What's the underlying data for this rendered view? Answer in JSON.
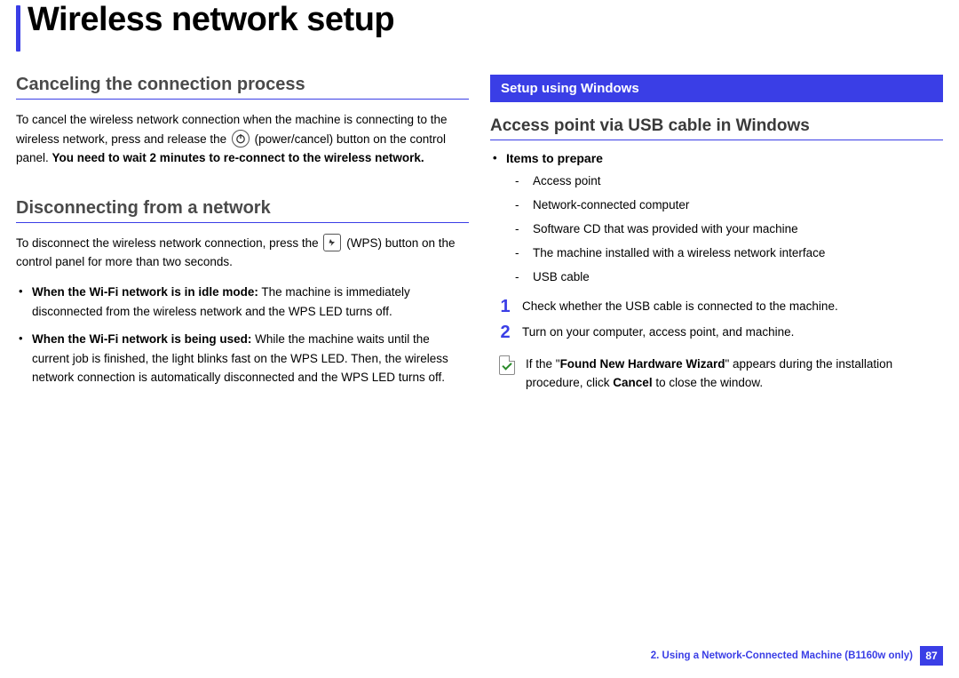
{
  "page_title": "Wireless network setup",
  "left": {
    "h_cancel": "Canceling the connection process",
    "p_cancel_pre_icon": "To cancel the wireless network connection when the machine is connecting to the wireless network, press and release the ",
    "p_cancel_post_icon": " (power/cancel) button on the control panel. ",
    "p_cancel_bold": "You need to wait 2 minutes to re-connect to the wireless network.",
    "h_disc": "Disconnecting from a network",
    "p_disc_pre_icon": "To disconnect the wireless network connection, press the ",
    "p_disc_post_icon": " (WPS) button on the control panel for more than two seconds.",
    "bullets": [
      {
        "bold": "When the Wi-Fi network is in idle mode:",
        "rest": " The machine is immediately disconnected from the wireless network and the WPS LED turns off."
      },
      {
        "bold": "When the Wi-Fi network is being used:",
        "rest": " While the machine waits until the current job is finished, the light blinks fast on the WPS LED. Then, the wireless network connection is automatically disconnected and the WPS LED turns off."
      }
    ]
  },
  "right": {
    "banner": "Setup using Windows",
    "h_access": "Access point via USB cable in Windows",
    "items_heading": "Items to prepare",
    "items": [
      "Access point",
      "Network-connected computer",
      "Software CD that was provided with your machine",
      "The machine installed with a wireless network interface",
      "USB cable"
    ],
    "steps": [
      {
        "num": "1",
        "text": "Check whether the USB cable is connected to the machine."
      },
      {
        "num": "2",
        "text": "Turn on your computer, access point, and machine."
      }
    ],
    "note_pre": "If the \"",
    "note_bold1": "Found New Hardware Wizard",
    "note_mid": "\" appears during the installation procedure, click ",
    "note_bold2": "Cancel",
    "note_post": " to close the window."
  },
  "footer": {
    "chapter": "2.  Using a Network-Connected Machine (B1160w only)",
    "page": "87"
  }
}
